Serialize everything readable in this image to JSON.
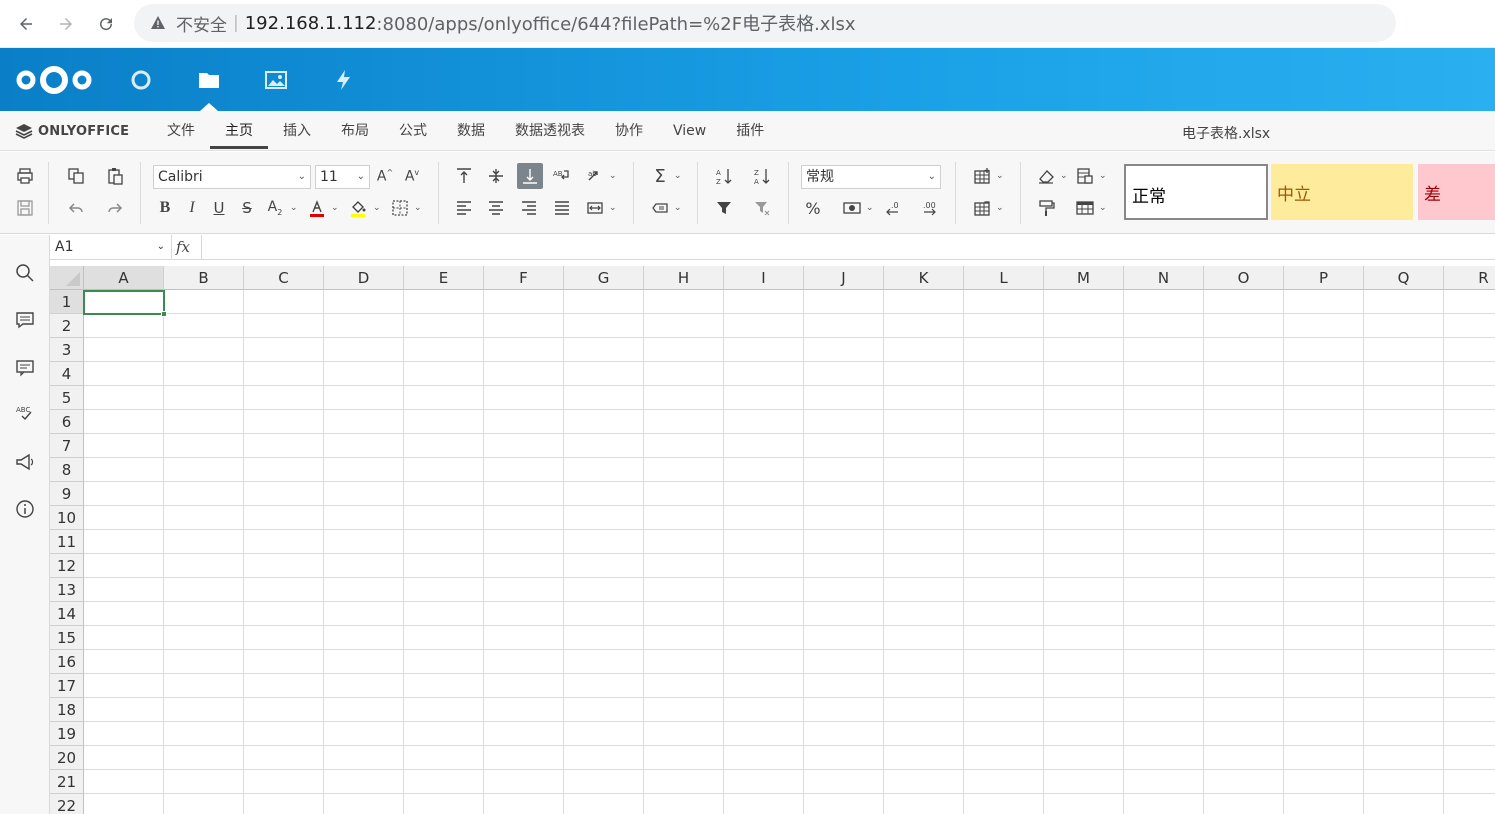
{
  "browser": {
    "insecure_label": "不安全",
    "separator": "|",
    "url_host": "192.168.1.112",
    "url_path": ":8080/apps/onlyoffice/644?filePath=%2F电子表格.xlsx"
  },
  "nextcloud": {
    "apps": [
      "dashboard",
      "files",
      "photos",
      "activity"
    ],
    "active_app": "files",
    "brand_color": "#0082c9"
  },
  "onlyoffice": {
    "logo_text": "ONLYOFFICE",
    "tabs": [
      "文件",
      "主页",
      "插入",
      "布局",
      "公式",
      "数据",
      "数据透视表",
      "协作",
      "View",
      "插件"
    ],
    "active_tab": "主页",
    "doc_title": "电子表格.xlsx"
  },
  "toolbar": {
    "font_name": "Calibri",
    "font_size": "11",
    "number_format": "常规",
    "bold": "B",
    "italic": "I",
    "underline": "U",
    "strike": "S",
    "percent": "%",
    "styles": [
      {
        "label": "正常",
        "bg": "#ffffff",
        "color": "#000000"
      },
      {
        "label": "中立",
        "bg": "#ffeb9c",
        "color": "#9c5700"
      },
      {
        "label": "差",
        "bg": "#ffc7ce",
        "color": "#9c0006"
      }
    ]
  },
  "formula_bar": {
    "name_box": "A1",
    "fx_label": "fx",
    "formula": ""
  },
  "sheet": {
    "columns": [
      "A",
      "B",
      "C",
      "D",
      "E",
      "F",
      "G",
      "H",
      "I",
      "J",
      "K",
      "L",
      "M",
      "N",
      "O",
      "P",
      "Q",
      "R"
    ],
    "rows": [
      "1",
      "2",
      "3",
      "4",
      "5",
      "6",
      "7",
      "8",
      "9",
      "10",
      "11",
      "12",
      "13",
      "14",
      "15",
      "16",
      "17",
      "18",
      "19",
      "20",
      "21",
      "22"
    ],
    "selected_cell": "A1"
  }
}
